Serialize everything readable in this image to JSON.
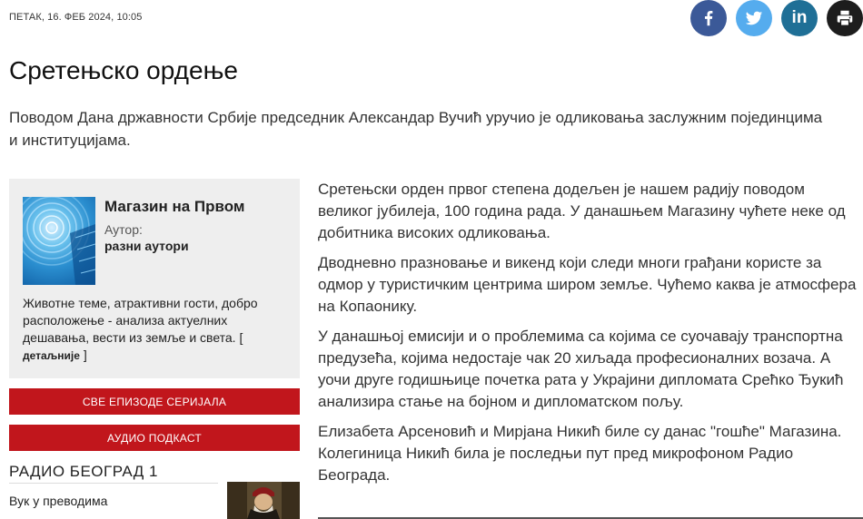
{
  "header": {
    "date": "ПЕТАК, 16. ФЕБ 2024,  10:05",
    "share": [
      {
        "name": "facebook",
        "icon": "facebook-icon",
        "color": "#3b5998"
      },
      {
        "name": "twitter",
        "icon": "twitter-icon",
        "color": "#55acee"
      },
      {
        "name": "linkedin",
        "icon": "linkedin-icon",
        "color": "#1f6f96"
      },
      {
        "name": "print",
        "icon": "print-icon",
        "color": "#1d1d1d"
      }
    ],
    "linkedin_glyph": "in"
  },
  "article": {
    "title": "Сретењско ордење",
    "lead": "Поводом Дана државности Србије председник Александар Вучић уручио је одликовања заслужним појединцима и институцијама.",
    "paragraphs": [
      "Сретењски орден првог степена додељен је нашем радију поводом великог јубилеја, 100 година рада. У данашњем Магазину чућете неке од добитника високих одликовања.",
      "Дводневно празновање и викенд који следи многи грађани користе за одмор у туристичким центрима широм земље. Чућемо каква је атмосфера на Копаонику.",
      "У  данашњој емисији и о проблемима са којима се суочавају транспортна предузећа, којима недостаје чак 20 хиљада професионалних возача. А уочи друге годишњице почетка рата у Украјини дипломата Срећко Ђукић анализира стање на бојном и дипломатском пољу.",
      "Елизабета Арсеновић и Мирјана Никић биле су данас \"гошће\" Магазина. Колегиница Никић била је последњи пут пред микрофоном Радио Београда."
    ]
  },
  "sidebar": {
    "show_name": "Магазин на Првом",
    "author_label": "Аутор:",
    "author_name": "разни аутори",
    "description": "Животне теме, атрактивни гости, добро расположење - анализа актуелних дешавања, вести из земље и света. [ ",
    "more_link": "детаљније",
    "description_end": " ]",
    "all_episodes_button": "СВЕ ЕПИЗОДЕ СЕРИЈАЛА",
    "podcast_button": "АУДИО ПОДКАСТ",
    "station": "РАДИО БЕОГРАД 1",
    "related_episode": "Вук у преводима"
  }
}
